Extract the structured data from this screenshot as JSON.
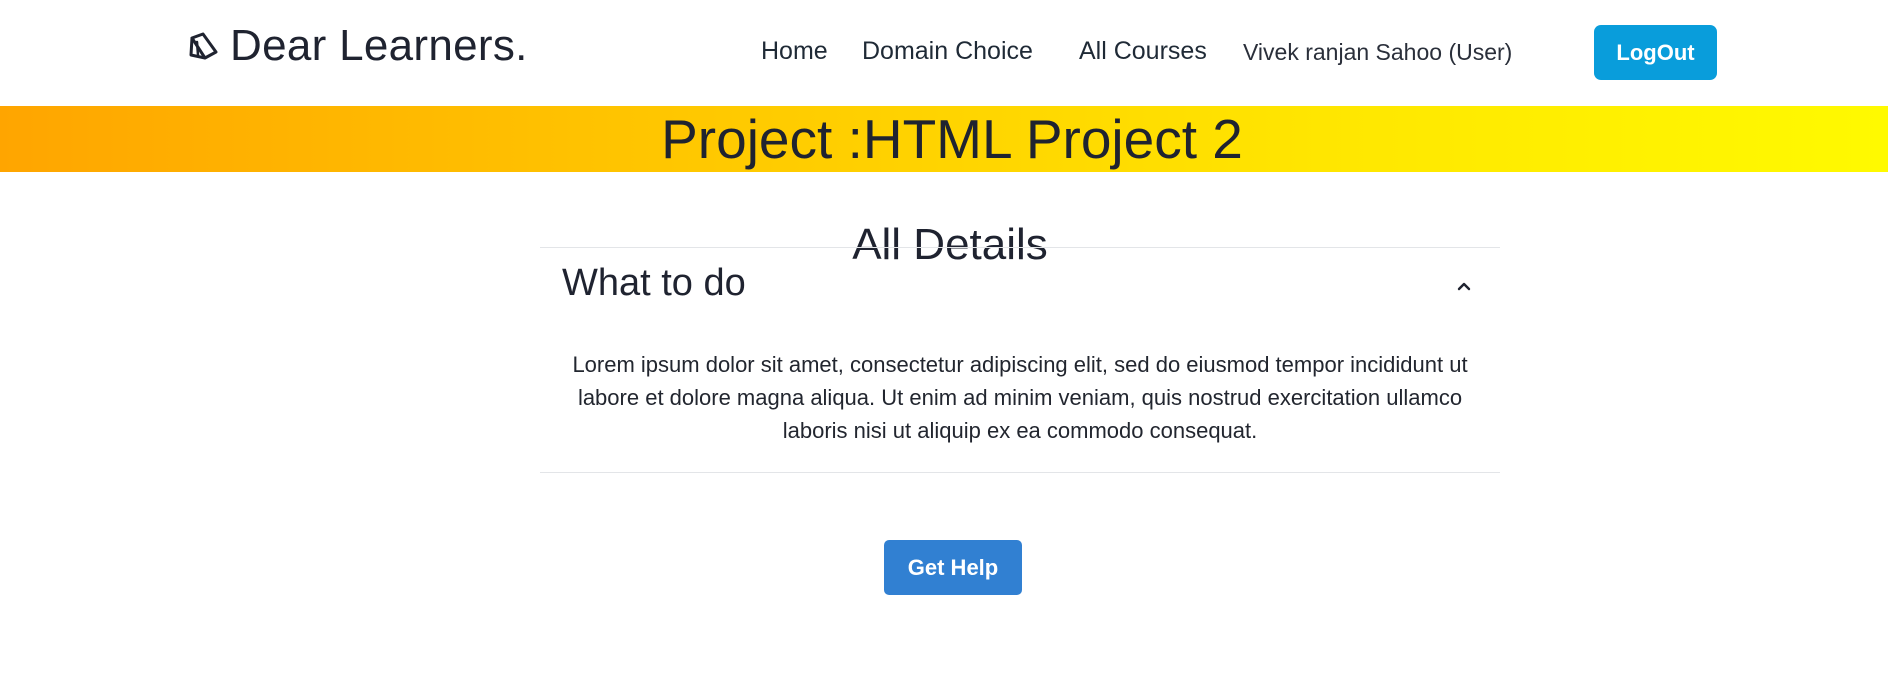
{
  "navbar": {
    "brand_icon": "book-open-icon",
    "brand_name": "Dear Learners.",
    "links": {
      "home": "Home",
      "domain_choice": "Domain Choice",
      "all_courses": "All Courses"
    },
    "user_label": "Vivek ranjan Sahoo (User)",
    "logout_label": "LogOut"
  },
  "banner": {
    "title": "Project :HTML Project 2"
  },
  "details": {
    "title": "All Details",
    "accordion": {
      "title": "What to do",
      "expanded": true,
      "toggle_icon": "chevron-up-icon",
      "body": "Lorem ipsum dolor sit amet, consectetur adipiscing elit, sed do eiusmod tempor incididunt ut labore et dolore magna aliqua. Ut enim ad minim veniam, quis nostrud exercitation ullamco laboris nisi ut aliquip ex ea commodo consequat."
    }
  },
  "actions": {
    "help_label": "Get Help"
  },
  "colors": {
    "logout_button": "#099ddb",
    "help_button": "#3180d2",
    "banner_gradient_start": "#ffa500",
    "banner_gradient_end": "#fffa00",
    "text": "#1f2330"
  }
}
